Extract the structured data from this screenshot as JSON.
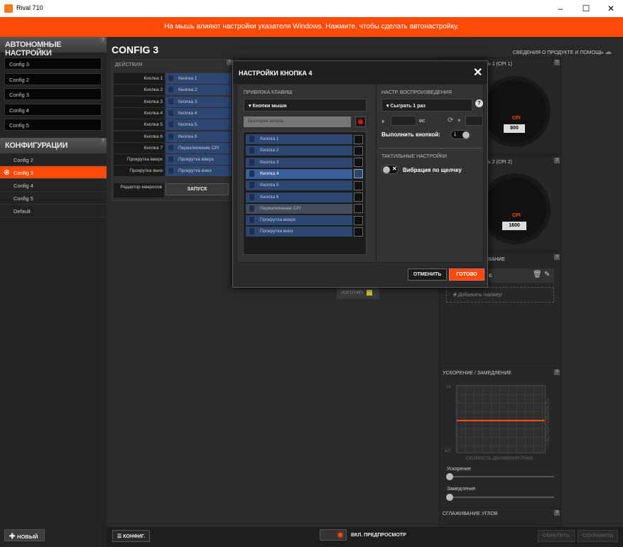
{
  "window": {
    "title": "Rival 710",
    "minimize": "–",
    "maximize": "☐",
    "close": "✕"
  },
  "banner": {
    "text": "На мышь влияют настройки указателя Windows. Нажмите, чтобы сделать автонастройку."
  },
  "sidebar": {
    "auto_header": "АВТОНОМНЫЕ НАСТРОЙКИ",
    "auto_items": [
      "Config 3",
      "Config 2",
      "Config 3",
      "Config 4",
      "Config 5"
    ],
    "configs_header": "КОНФИГУРАЦИИ",
    "configs": [
      "Config 2",
      "Config 3",
      "Config 4",
      "Config 5",
      "Default"
    ],
    "active_config": "Config 3",
    "new_button": "НОВЫЙ",
    "help": "?"
  },
  "main": {
    "title": "CONFIG 3",
    "support_link": "СВЕДЕНИЯ О ПРОДУКТЕ И ПОМОЩЬ",
    "actions_label": "ДЕЙСТВИЯ",
    "actions": [
      {
        "label": "Кнопка 1",
        "value": "Кнопка 1"
      },
      {
        "label": "Кнопка 2",
        "value": "Кнопка 2"
      },
      {
        "label": "Кнопка 3",
        "value": "Кнопка 3"
      },
      {
        "label": "Кнопка 4",
        "value": "Кнопка 4"
      },
      {
        "label": "Кнопка 5",
        "value": "Кнопка 5"
      },
      {
        "label": "Кнопка 6",
        "value": "Кнопка 6"
      },
      {
        "label": "Кнопка 7",
        "value": "Переключение CPI"
      },
      {
        "label": "Прокрутка вверх",
        "value": "Прокрутка вверх"
      },
      {
        "label": "Прокрутка вниз",
        "value": "Прокрутка вниз"
      }
    ],
    "macro_editor": "Редактор макросов",
    "launch_button": "ЗАПУСК",
    "logo_label": "ЛОГОТИП"
  },
  "right": {
    "cpi1_label": "ТЬ 1 (CPI 1)",
    "cpi1_value": "800",
    "cpi2_label": "ТЬ 2 (CPI 2)",
    "cpi2_value": "1600",
    "cpi_unit": "CPI",
    "illum_label": "ИВАНИЕ",
    "illum_item": "с",
    "add_timer": "Добавить таймер",
    "accel_header": "УСКОРЕНИЕ / ЗАМЕДЛЕНИЕ",
    "graph_y_top": "2x",
    "graph_y_bottom": "1/2",
    "graph_xlabel": "СКОРОСТЬ ДВИЖЕНИЯ РУКИ",
    "graph_ylabel": "ЧУВСТВИТЕЛЬНОСТЬ",
    "accel_label": "Ускорение",
    "decel_label": "Замедление",
    "angle_header": "СГЛАЖИВАНИЕ УГЛОВ"
  },
  "dialog": {
    "title": "НАСТРОЙКИ КНОПКА 4",
    "close": "✕",
    "binding_label": "ПРИВЯЗКА КЛАВИШ",
    "binding_dropdown": "Кнопки мыши",
    "quick_record": "Быстрая запись",
    "mouse_buttons": [
      {
        "label": "Кнопка 1",
        "state": "normal"
      },
      {
        "label": "Кнопка 2",
        "state": "normal"
      },
      {
        "label": "Кнопка 3",
        "state": "normal"
      },
      {
        "label": "Кнопка 4",
        "state": "selected"
      },
      {
        "label": "Кнопка 5",
        "state": "normal"
      },
      {
        "label": "Кнопка 6",
        "state": "normal"
      },
      {
        "label": "Переключение CPI",
        "state": "grey"
      },
      {
        "label": "Прокрутка вверх",
        "state": "normal"
      },
      {
        "label": "Прокрутка вниз",
        "state": "normal"
      }
    ],
    "playback_label": "НАСТР. ВОСПРОИЗВЕДЕНИЯ",
    "playback_dropdown": "Сыграть 1 раз",
    "ms_label": "мс",
    "repeat_x": "×",
    "execute_by_button": "Выполнить кнопкой:",
    "tactile_label": "ТАКТИЛЬНЫЕ НАСТРОЙКИ",
    "vibration_label": "Вибрация по щелчку",
    "cancel_button": "ОТМЕНИТЬ",
    "done_button": "ГОТОВО"
  },
  "bottom": {
    "config_button": "КОНФИГ.",
    "preview_label": "ВКЛ. ПРЕДПРОСМОТР",
    "revert_button": "ОБРАТИТЬ",
    "save_button": "СОХРАНИТЬ"
  },
  "colors": {
    "accent": "#fc4b08",
    "selection": "#2d4672"
  }
}
